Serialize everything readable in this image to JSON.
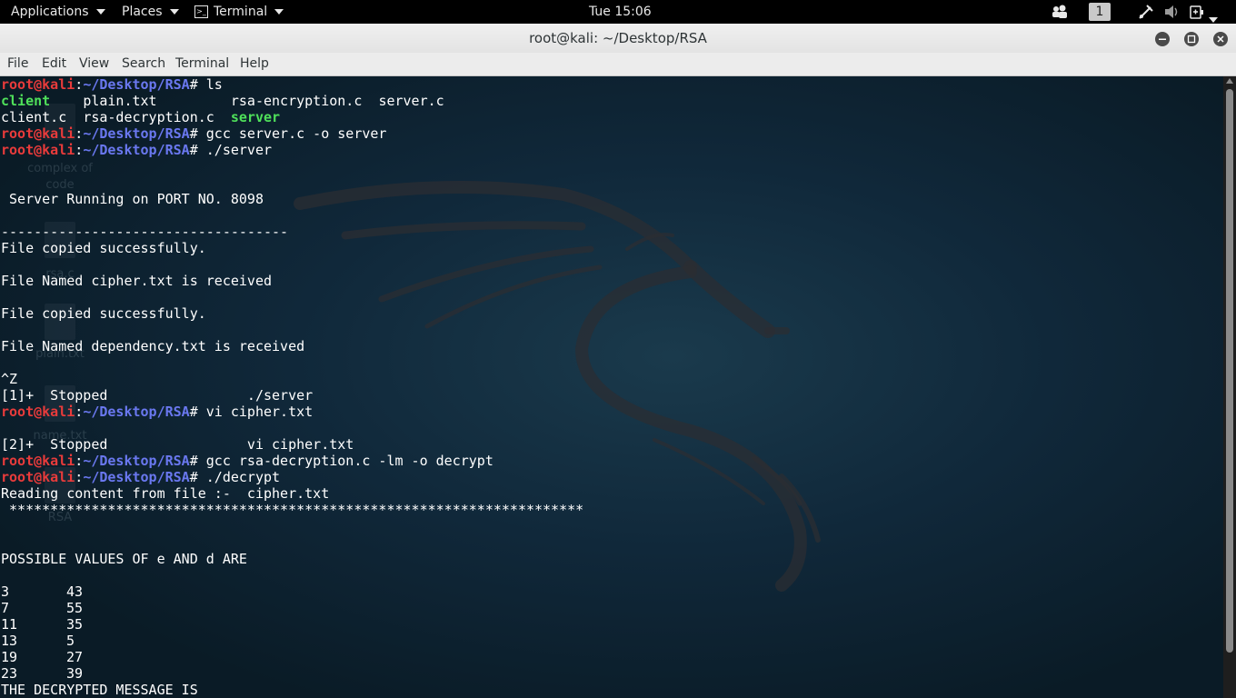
{
  "top_panel": {
    "applications": "Applications",
    "places": "Places",
    "terminal_app": "Terminal",
    "clock": "Tue 15:06",
    "workspace": "1"
  },
  "window": {
    "title": "root@kali: ~/Desktop/RSA"
  },
  "menu": [
    "File",
    "Edit",
    "View",
    "Search",
    "Terminal",
    "Help"
  ],
  "prompt": {
    "user": "root@kali",
    "path": "~/Desktop/RSA"
  },
  "terminal": {
    "cmd_ls": "# ls",
    "ls_row1": [
      "client",
      "plain.txt",
      "rsa-encryption.c",
      "server.c"
    ],
    "ls_row2": [
      "client.c",
      "rsa-decryption.c",
      "server"
    ],
    "cmd_gcc_server": "# gcc server.c -o server",
    "cmd_run_server": "# ./server",
    "server_running": " Server Running on PORT NO. 8098",
    "dashes": "-----------------------------------",
    "copied1": "File copied successfully.",
    "received1": "File Named cipher.txt is received",
    "copied2": "File copied successfully.",
    "received2": "File Named dependency.txt is received",
    "ctrl_z": "^Z",
    "stopped1": "[1]+  Stopped                 ./server",
    "cmd_vi": "# vi cipher.txt",
    "stopped2": "[2]+  Stopped                 vi cipher.txt",
    "cmd_gcc_decrypt": "# gcc rsa-decryption.c -lm -o decrypt",
    "cmd_run_decrypt": "# ./decrypt",
    "reading": "Reading content from file :-  cipher.txt",
    "stars": " **********************************************************************",
    "possible": "POSSIBLE VALUES OF e AND d ARE",
    "pairs": [
      [
        "3",
        "43"
      ],
      [
        "7",
        "55"
      ],
      [
        "11",
        "35"
      ],
      [
        "13",
        "5"
      ],
      [
        "19",
        "27"
      ],
      [
        "23",
        "39"
      ]
    ],
    "decrypted": "THE DECRYPTED MESSAGE IS"
  },
  "desktop_ghost_labels": [
    "complex of",
    "code",
    "rsa.c",
    "plain.txt",
    "name.txt",
    "RSA"
  ],
  "colors": {
    "prompt_user": "#e83b3b",
    "prompt_path": "#6a78f0",
    "executable": "#4fe05a",
    "terminal_bg": "#10283a"
  }
}
